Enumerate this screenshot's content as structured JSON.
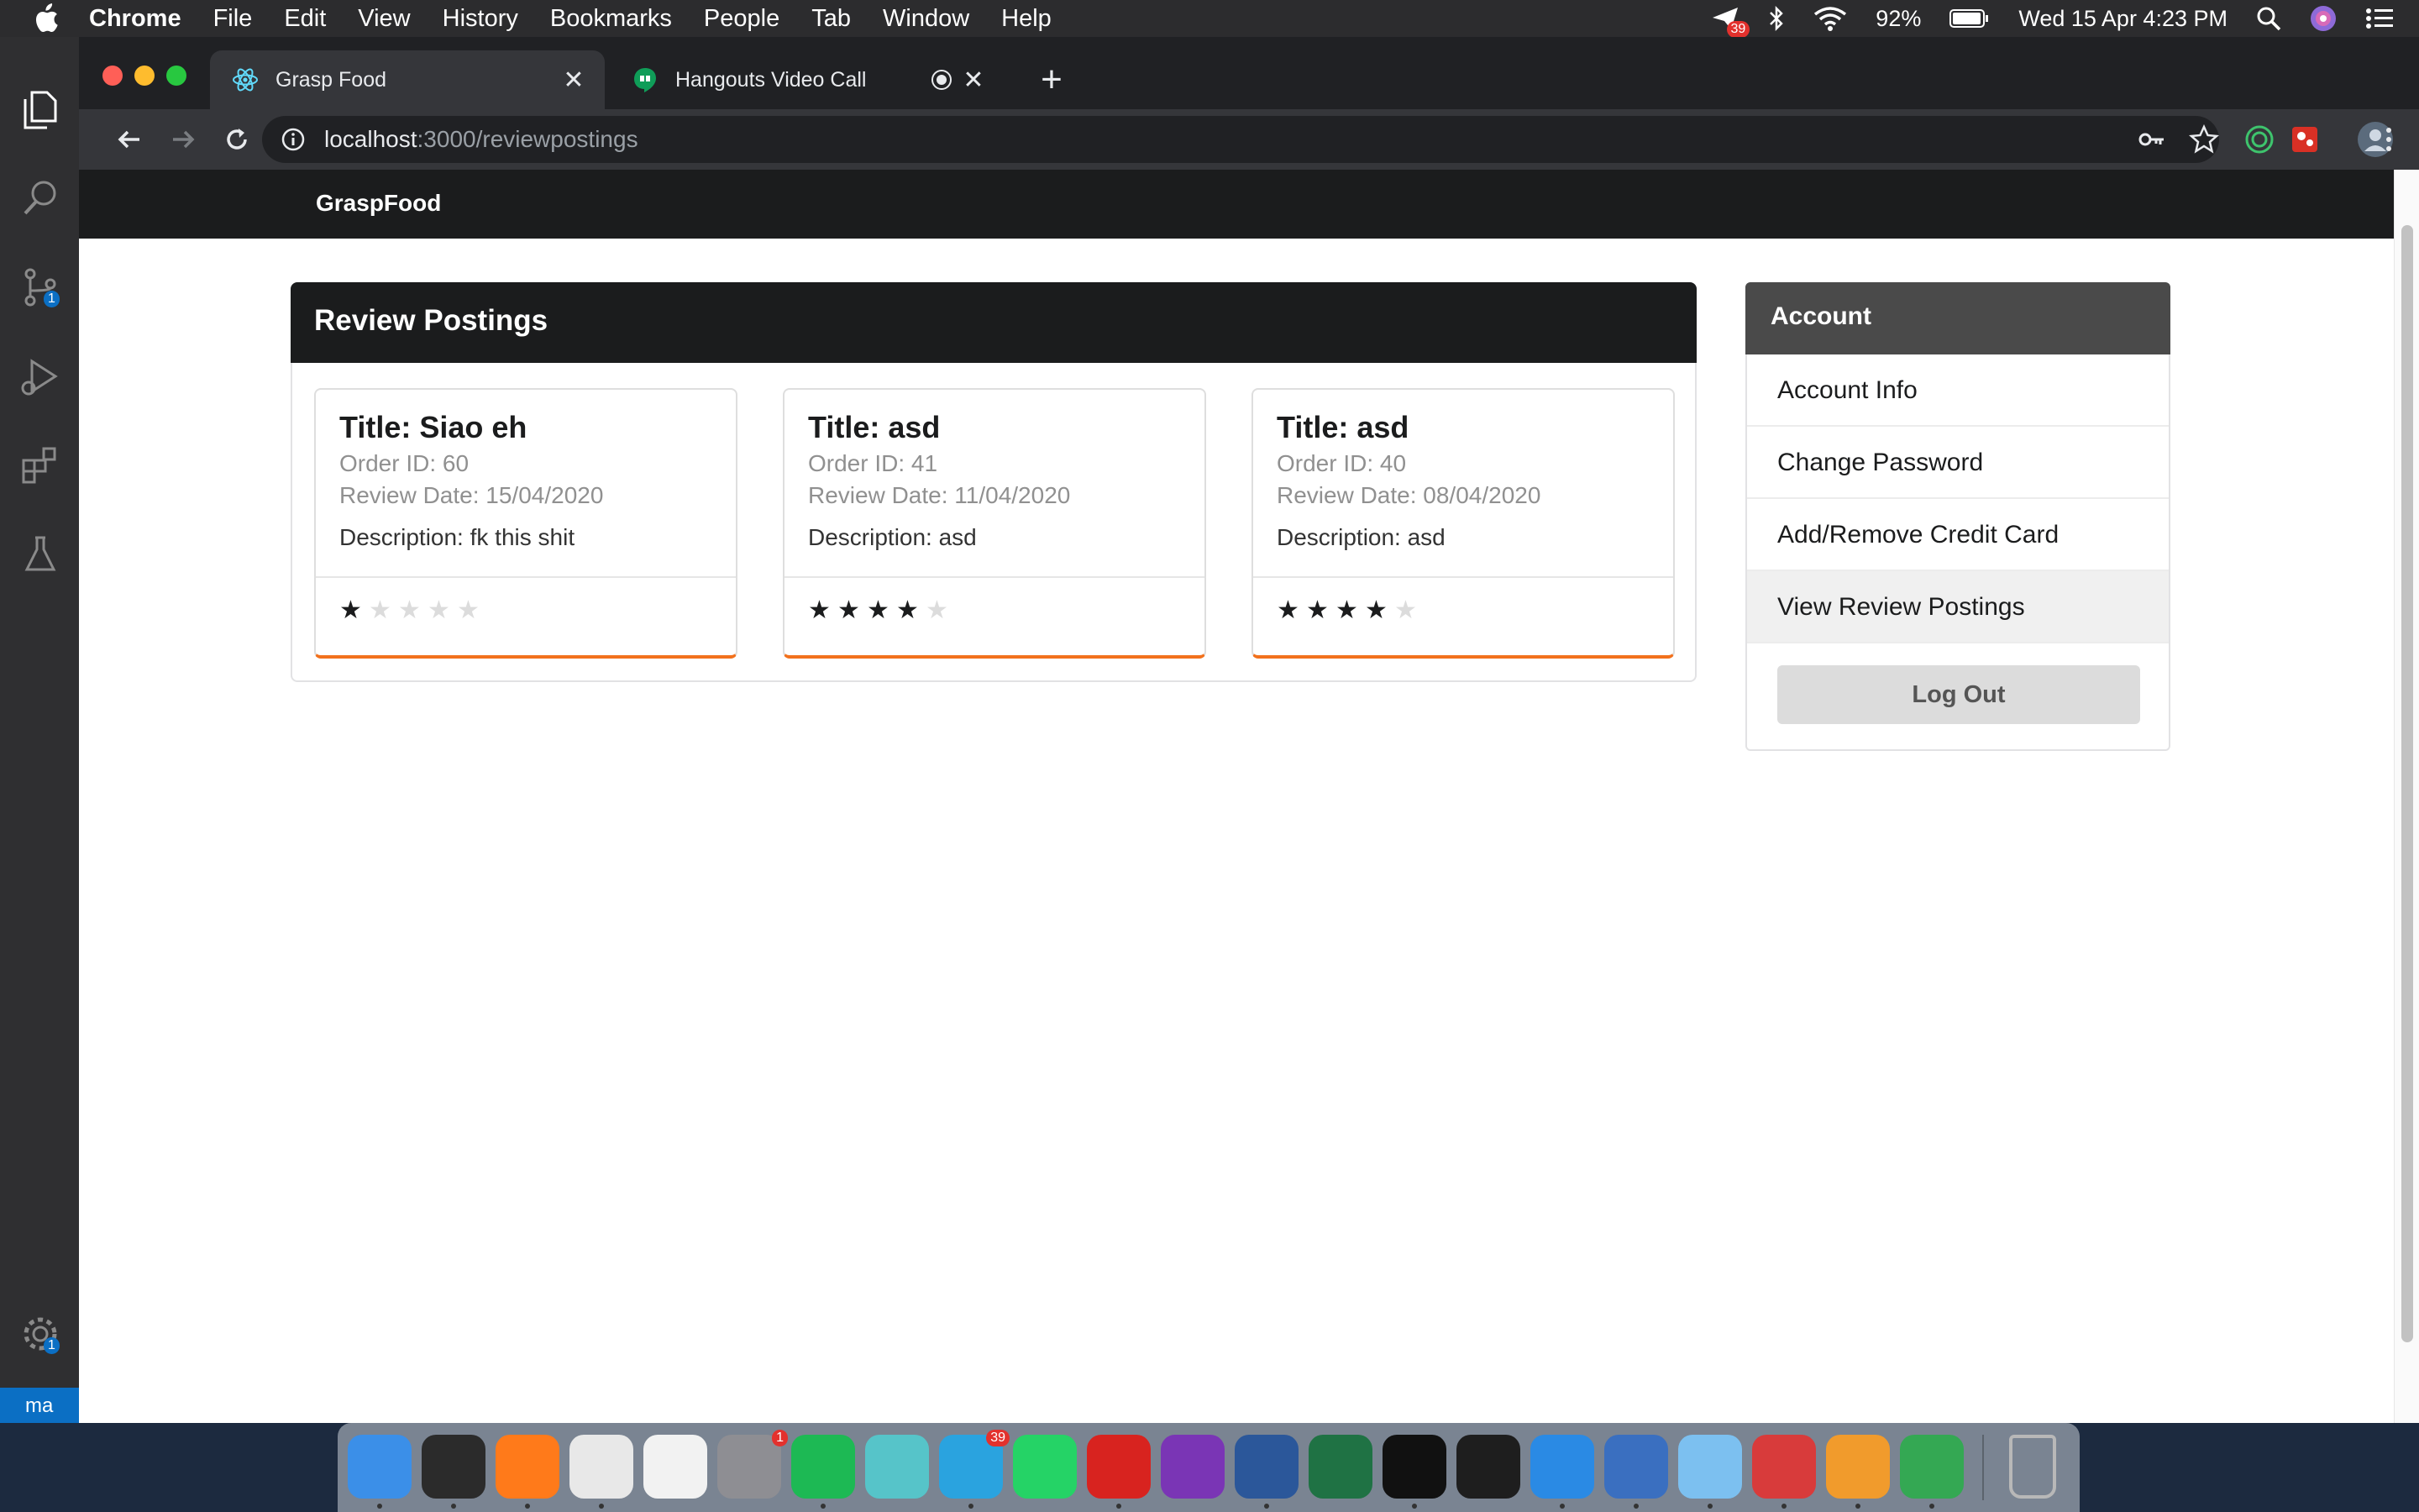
{
  "menubar": {
    "app_name": "Chrome",
    "items": [
      "File",
      "Edit",
      "View",
      "History",
      "Bookmarks",
      "People",
      "Tab",
      "Window",
      "Help"
    ],
    "notification_badge": "39",
    "battery": "92%",
    "clock": "Wed 15 Apr  4:23 PM"
  },
  "vscode": {
    "scm_badge": "1",
    "settings_badge": "1",
    "status_branch": "ma"
  },
  "browser": {
    "tabs": [
      {
        "title": "Grasp Food",
        "active": true
      },
      {
        "title": "Hangouts Video Call",
        "active": false
      }
    ],
    "url_host": "localhost",
    "url_path": ":3000/reviewpostings"
  },
  "app": {
    "brand": "GraspFood",
    "review_panel_title": "Review Postings",
    "reviews": [
      {
        "title": "Title: Siao eh",
        "order": "Order ID: 60",
        "date": "Review Date: 15/04/2020",
        "description": "Description: fk this shit",
        "rating": 1
      },
      {
        "title": "Title: asd",
        "order": "Order ID: 41",
        "date": "Review Date: 11/04/2020",
        "description": "Description: asd",
        "rating": 4
      },
      {
        "title": "Title: asd",
        "order": "Order ID: 40",
        "date": "Review Date: 08/04/2020",
        "description": "Description: asd",
        "rating": 4
      }
    ],
    "max_rating": 5,
    "account": {
      "title": "Account",
      "items": [
        "Account Info",
        "Change Password",
        "Add/Remove Credit Card",
        "View Review Postings"
      ],
      "active_item": "View Review Postings",
      "logout_label": "Log Out"
    }
  },
  "dock": {
    "apps": [
      "finder-icon",
      "activity-monitor-icon",
      "firefox-icon",
      "chrome-icon",
      "textedit-icon",
      "system-preferences-icon",
      "spotify-icon",
      "star-app-icon",
      "telegram-icon",
      "whatsapp-icon",
      "acrobat-icon",
      "onenote-icon",
      "word-icon",
      "excel-icon",
      "terminal-icon",
      "terminal2-icon",
      "vscode-icon",
      "sap-icon",
      "cube-icon",
      "red-app-icon",
      "sublime-icon",
      "vim-icon",
      "trash-icon"
    ],
    "telegram_badge": "39",
    "prefs_badge": "1"
  },
  "colors": {
    "card_accent": "#f2711c",
    "navbar": "#1b1c1d",
    "account_header": "#4a4a4a"
  }
}
